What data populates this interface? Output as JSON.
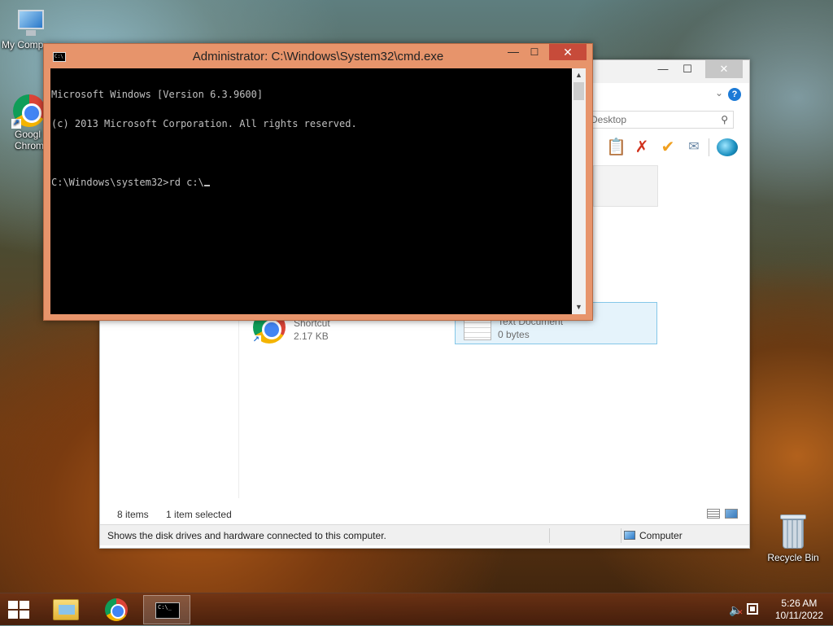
{
  "desktop": {
    "icons": [
      {
        "label": "My Comp"
      },
      {
        "label": "Googl\nChrom"
      },
      {
        "label": "Recycle Bin"
      }
    ]
  },
  "explorer": {
    "title_buttons": {
      "minimize": "—",
      "maximize": "☐",
      "close": "✕"
    },
    "help": "?",
    "chevron": "⌄",
    "search_placeholder": "rch Desktop",
    "toolbar": {
      "paste": "📋",
      "delete": "✗",
      "check": "✔",
      "properties": "✉"
    },
    "items": [
      {
        "type": "Shortcut",
        "size": "2.17 KB"
      },
      {
        "type": "Text Document",
        "size": "0 bytes"
      }
    ],
    "status": {
      "count": "8 items",
      "selected": "1 item selected"
    },
    "infobar": {
      "text": "Shows the disk drives and hardware connected to this computer.",
      "location": "Computer"
    }
  },
  "cmd": {
    "title": "Administrator: C:\\Windows\\System32\\cmd.exe",
    "icon_text": "C:\\",
    "buttons": {
      "minimize": "—",
      "maximize": "☐",
      "close": "✕"
    },
    "lines": [
      "Microsoft Windows [Version 6.3.9600]",
      "(c) 2013 Microsoft Corporation. All rights reserved.",
      "",
      "C:\\Windows\\system32>rd c:\\"
    ],
    "scroll": {
      "up": "▲",
      "down": "▼"
    }
  },
  "taskbar": {
    "cmd_mini_text": "C:\\_",
    "clock": {
      "time": "5:26 AM",
      "date": "10/11/2022"
    },
    "tray": {
      "speaker": "🔈",
      "muted_mark": "✕"
    }
  },
  "colors": {
    "cmd_frame": "#e7946b",
    "cmd_close": "#c74b3a",
    "selection": "#e5f3fb",
    "selection_border": "#84c7e8"
  }
}
